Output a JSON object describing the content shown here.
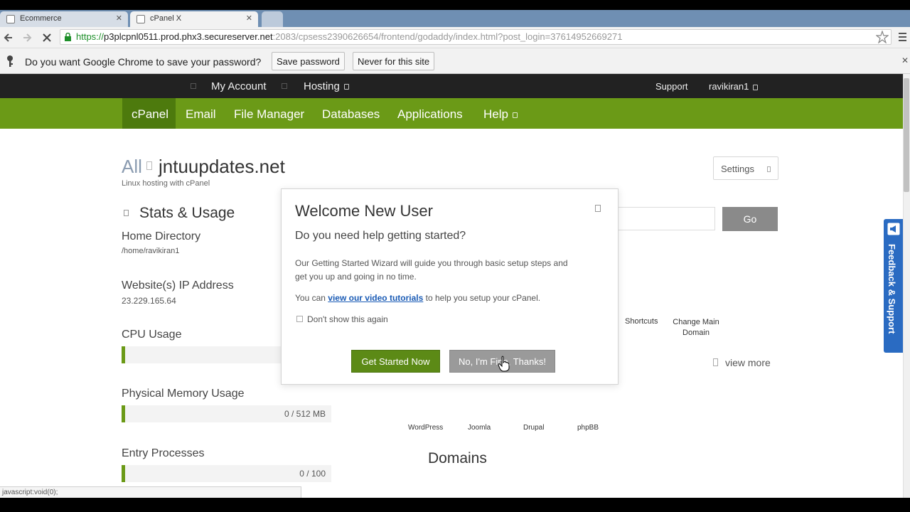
{
  "browser": {
    "tabs": [
      {
        "label": "Ecommerce",
        "active": false
      },
      {
        "label": "cPanel X",
        "active": true
      }
    ],
    "url": {
      "protocol": "https://",
      "host": "p3plcpnl0511.prod.phx3.secureserver.net",
      "rest": ":2083/cpsess2390626654/frontend/godaddy/index.html?post_login=37614952669271"
    },
    "password_bar": {
      "prompt": "Do you want Google Chrome to save your password?",
      "save_label": "Save password",
      "never_label": "Never for this site"
    },
    "status_text": "javascript:void(0);"
  },
  "topnav": {
    "my_account": "My Account",
    "hosting": "Hosting",
    "support": "Support",
    "username": "ravikiran1"
  },
  "mainnav": {
    "items": [
      "cPanel",
      "Email",
      "File Manager",
      "Databases",
      "Applications",
      "Help"
    ]
  },
  "header": {
    "all": "All",
    "domain": "jntuupdates.net",
    "subtitle": "Linux hosting with cPanel",
    "settings": "Settings"
  },
  "stats": {
    "title": "Stats & Usage",
    "home_dir_label": "Home Directory",
    "home_dir_value": "/home/ravikiran1",
    "ip_label": "Website(s) IP Address",
    "ip_value": "23.229.165.64",
    "cpu_label": "CPU Usage",
    "memory_label": "Physical Memory Usage",
    "memory_value": "0 / 512 MB",
    "memory_fraction": 0,
    "entry_label": "Entry Processes",
    "entry_value": "0 / 100",
    "entry_fraction": 0
  },
  "right": {
    "go": "Go",
    "shortcuts": "Shortcuts",
    "change_main_1": "Change Main",
    "change_main_2": "Domain",
    "view_more": "view more",
    "apps": [
      "WordPress",
      "Joomla",
      "Drupal",
      "phpBB"
    ],
    "domains_title": "Domains"
  },
  "modal": {
    "title": "Welcome New User",
    "question": "Do you need help getting started?",
    "body1": "Our Getting Started Wizard will guide you through basic setup steps and",
    "body2": "get you up and going in no time.",
    "body3_prefix": "You can",
    "body3_link": "view our video tutorials",
    "body3_suffix": "to help you setup your cPanel.",
    "checkbox": "Don't show this again",
    "primary": "Get Started Now",
    "secondary": "No, I'm Fine, Thanks!"
  },
  "feedback": "Feedback & Support",
  "colors": {
    "green_nav": "#6b9a17",
    "dark_nav": "#222222",
    "primary_button": "#5c8a16",
    "feedback_blue": "#2a6bc2"
  }
}
